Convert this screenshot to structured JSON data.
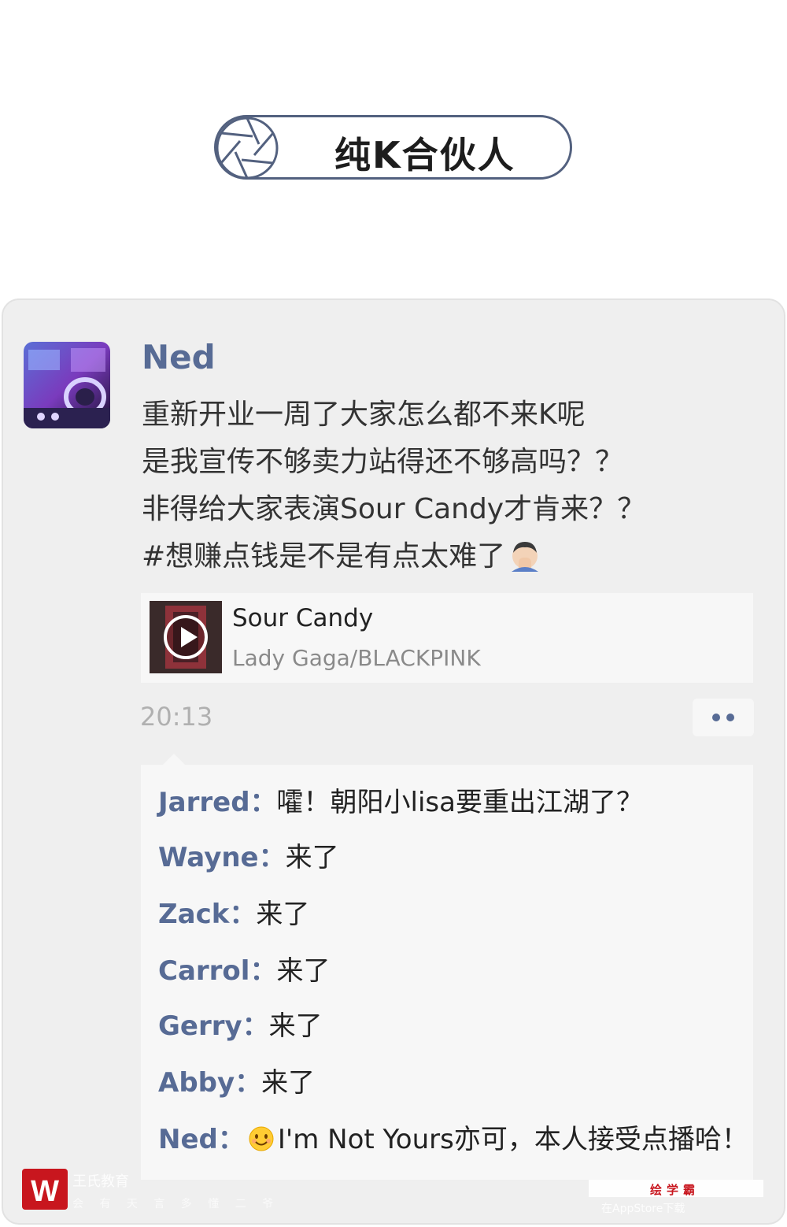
{
  "header": {
    "title": "纯K合伙人"
  },
  "post": {
    "author": "Ned",
    "lines": [
      "重新开业一周了大家怎么都不来K呢",
      "是我宣传不够卖力站得还不够高吗？？",
      "非得给大家表演Sour Candy才肯来？？",
      "#想赚点钱是不是有点太难了"
    ],
    "music": {
      "title": "Sour Candy",
      "artist": "Lady Gaga/BLACKPINK"
    },
    "time": "20:13"
  },
  "comments": [
    {
      "name": "Jarred",
      "sep": "：",
      "text": "嚯！朝阳小lisa要重出江湖了？"
    },
    {
      "name": "Wayne",
      "sep": "：",
      "text": "来了"
    },
    {
      "name": "Zack",
      "sep": "：",
      "text": "来了"
    },
    {
      "name": "Carrol",
      "sep": "：",
      "text": "来了"
    },
    {
      "name": "Gerry",
      "sep": "：",
      "text": "来了"
    },
    {
      "name": "Abby",
      "sep": "：",
      "text": "来了"
    },
    {
      "name": "Ned",
      "sep": "：",
      "text": "I'm Not Yours亦可，本人接受点播哈！"
    }
  ],
  "watermarks": {
    "left_logo": "W",
    "left_text": "王氏教育",
    "left_sub": "会 有 天 言 多 懂 二 爷",
    "right_logo": "绘学霸",
    "right_text": "在AppStore下载",
    "colors": {
      "brand_red": "#c8161e"
    }
  },
  "colors": {
    "name_blue": "#576b95",
    "title_border": "#53617f",
    "card_bg": "#efefef"
  },
  "icons": [
    "camera-shutter-icon",
    "play-icon",
    "facepalm-emoji",
    "smiling-emoji",
    "more-dots-icon"
  ]
}
